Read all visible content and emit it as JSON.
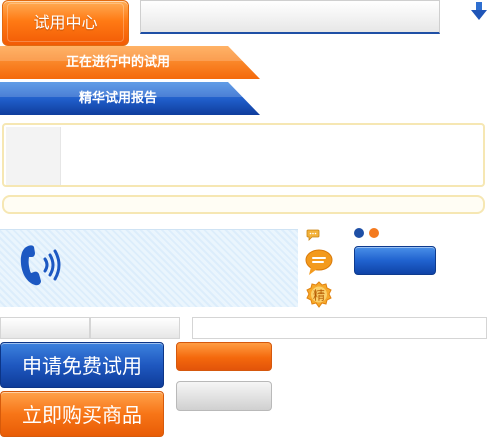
{
  "header": {
    "trial_center_label": "试用中心"
  },
  "tabs": {
    "ongoing_label": "正在进行中的试用",
    "reports_label": "精华试用报告"
  },
  "buttons": {
    "apply_label": "申请免费试用",
    "buy_label": "立即购买商品"
  },
  "icons": {
    "jing_badge": "精",
    "names": [
      "down-arrow-icon",
      "phone-icon",
      "chat-small-icon",
      "chat-bubble-icon",
      "jing-badge-icon"
    ]
  },
  "colors": {
    "orange": "#f4690b",
    "blue": "#1f5cc8",
    "cream_border": "#f6e7b3"
  }
}
